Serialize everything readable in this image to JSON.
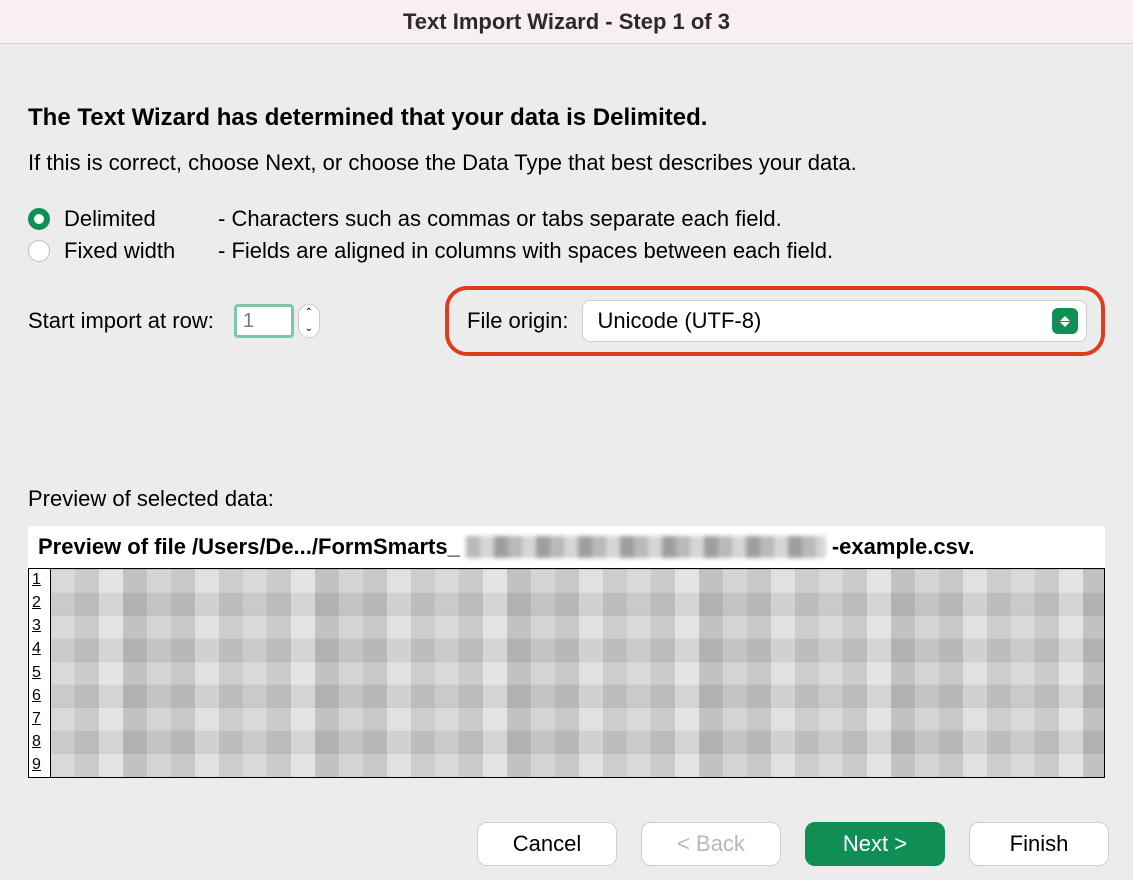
{
  "window": {
    "title": "Text Import Wizard - Step 1 of 3"
  },
  "heading": "The Text Wizard has determined that your data is Delimited.",
  "subtext": "If this is correct, choose Next, or choose the Data Type that best describes your data.",
  "options": {
    "delimited": {
      "label": "Delimited",
      "desc": "- Characters such as commas or tabs separate each field.",
      "selected": true
    },
    "fixed": {
      "label": "Fixed width",
      "desc": "- Fields are aligned in columns with spaces between each field.",
      "selected": false
    }
  },
  "start_row": {
    "label": "Start import at row:",
    "value": "1"
  },
  "file_origin": {
    "label": "File origin:",
    "value": "Unicode (UTF-8)"
  },
  "preview": {
    "label": "Preview of selected data:",
    "file_prefix": "Preview of file /Users/De.../FormSmarts_",
    "file_suffix": "-example.csv.",
    "row_numbers": [
      "1",
      "2",
      "3",
      "4",
      "5",
      "6",
      "7",
      "8",
      "9"
    ]
  },
  "buttons": {
    "cancel": "Cancel",
    "back": "< Back",
    "next": "Next >",
    "finish": "Finish"
  }
}
